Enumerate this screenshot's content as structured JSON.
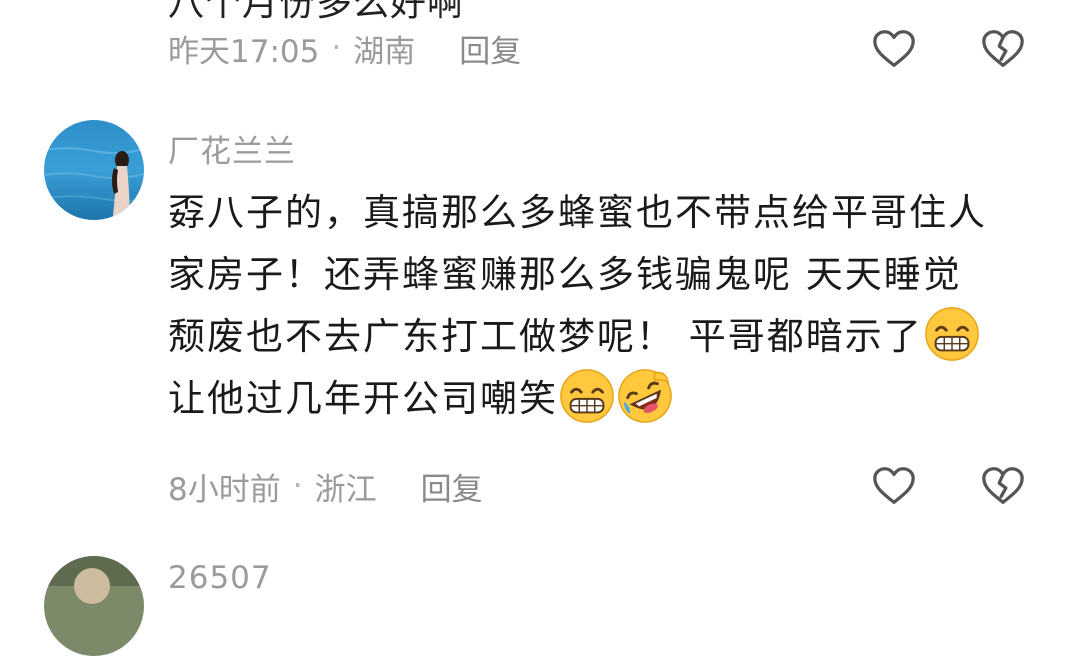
{
  "previous_comment": {
    "cut_text": "八个月份多么好啊",
    "time": "昨天17:05",
    "location": "湖南",
    "reply_label": "回复"
  },
  "comment": {
    "username": "厂花兰兰",
    "lines": [
      "孬八子的，真搞那么多蜂蜜也不带点给平哥住人",
      "家房子！还弄蜂蜜赚那么多钱骗鬼呢 天天睡觉",
      "颓废也不去广东打工做梦呢！ 平哥都暗示了",
      "让他过几年开公司嘲笑"
    ],
    "time": "8小时前",
    "location": "浙江",
    "reply_label": "回复"
  },
  "next_comment": {
    "username_partial": "26507"
  },
  "icons": {
    "like": "heart-outline-icon",
    "dislike": "broken-heart-outline-icon",
    "emoji_grin": "grinning-face-emoji",
    "emoji_laugh": "rofl-emoji"
  },
  "colors": {
    "text": "#1a1a1a",
    "meta": "#9b9b9b",
    "icon": "#555555",
    "emoji_yellow": "#ffc83d"
  }
}
